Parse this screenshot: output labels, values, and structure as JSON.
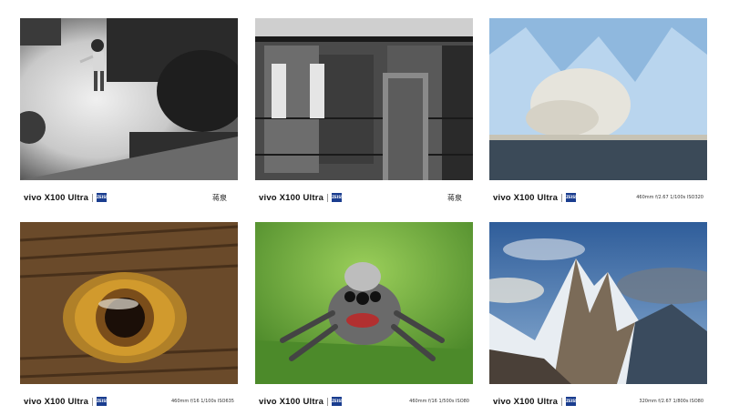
{
  "brand": "vivo X100 Ultra",
  "zeiss_text": "ZEISS",
  "cards": [
    {
      "spec": "",
      "signature": "蒋泉"
    },
    {
      "spec": "",
      "signature": "蒋泉"
    },
    {
      "spec": "460mm f/2.67 1/100s ISO320",
      "signature": ""
    },
    {
      "spec": "460mm f/16 1/100s ISO635",
      "signature": ""
    },
    {
      "spec": "460mm f/16 1/500s ISO80",
      "signature": ""
    },
    {
      "spec": "320mm f/2.67 1/800s ISO80",
      "signature": ""
    }
  ]
}
